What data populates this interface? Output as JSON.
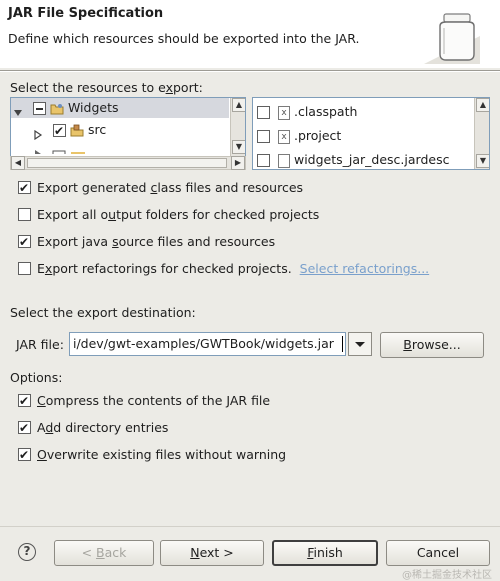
{
  "header": {
    "title": "JAR File Specification",
    "description": "Define which resources should be exported into the JAR."
  },
  "resources": {
    "label": "Select the resources to export:",
    "tree": [
      {
        "label": "Widgets",
        "state": "partial",
        "expanded": true
      },
      {
        "label": "src",
        "state": "checked",
        "expanded": false
      }
    ],
    "files": [
      {
        "label": ".classpath",
        "checked": false
      },
      {
        "label": ".project",
        "checked": false
      },
      {
        "label": "widgets_jar_desc.jardesc",
        "checked": false
      }
    ]
  },
  "options_export": [
    {
      "label": "Export generated class files and resources",
      "checked": true
    },
    {
      "label": "Export all output folders for checked projects",
      "checked": false
    },
    {
      "label": "Export java source files and resources",
      "checked": true
    },
    {
      "label": "Export refactorings for checked projects.",
      "checked": false
    }
  ],
  "select_refactorings_link": "Select refactorings...",
  "destination": {
    "label": "Select the export destination:",
    "jar_label": "JAR file:",
    "jar_value": "i/dev/gwt-examples/GWTBook/widgets.jar",
    "browse_label": "Browse..."
  },
  "options": {
    "label": "Options:",
    "items": [
      {
        "label": "Compress the contents of the JAR file",
        "checked": true
      },
      {
        "label": "Add directory entries",
        "checked": true
      },
      {
        "label": "Overwrite existing files without warning",
        "checked": true
      }
    ]
  },
  "buttons": {
    "help": "?",
    "back": "< Back",
    "next": "Next >",
    "finish": "Finish",
    "cancel": "Cancel"
  },
  "watermark": "@稀土掘金技术社区"
}
